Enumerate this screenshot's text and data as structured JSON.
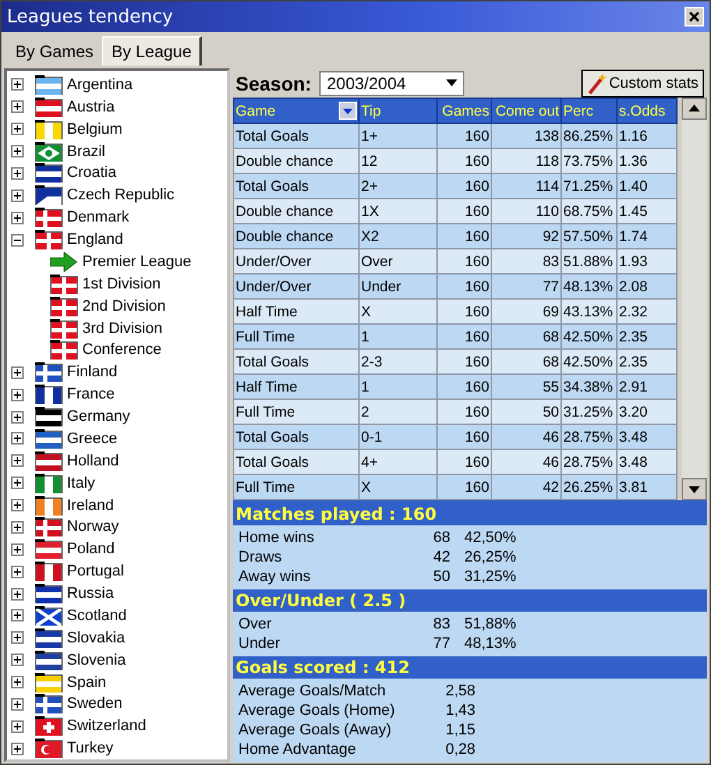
{
  "window": {
    "title": "Leagues tendency"
  },
  "tabs": [
    {
      "label": "By Games",
      "selected": false
    },
    {
      "label": "By League",
      "selected": true
    }
  ],
  "tree": [
    {
      "label": "Argentina",
      "expanded": false,
      "kind": "h",
      "color": "#6cb4ee"
    },
    {
      "label": "Austria",
      "expanded": false,
      "kind": "h",
      "color": "#e01020"
    },
    {
      "label": "Belgium",
      "expanded": false,
      "kind": "v",
      "color": "#f8d800"
    },
    {
      "label": "Brazil",
      "expanded": false,
      "kind": "diamond",
      "color": "#109030"
    },
    {
      "label": "Croatia",
      "expanded": false,
      "kind": "h",
      "color": "#1030a0"
    },
    {
      "label": "Czech Republic",
      "expanded": false,
      "kind": "triangle",
      "color": "#1030a0"
    },
    {
      "label": "Denmark",
      "expanded": false,
      "kind": "nordic",
      "color": "#e01020"
    },
    {
      "label": "England",
      "expanded": true,
      "kind": "cross",
      "color": "#e01020",
      "children": [
        {
          "label": "Premier League",
          "kind": "arrow"
        },
        {
          "label": "1st Division",
          "kind": "flag"
        },
        {
          "label": "2nd Division",
          "kind": "flag"
        },
        {
          "label": "3rd Division",
          "kind": "flag"
        },
        {
          "label": "Conference",
          "kind": "flag"
        }
      ]
    },
    {
      "label": "Finland",
      "expanded": false,
      "kind": "nordic",
      "color": "#2050c0"
    },
    {
      "label": "France",
      "expanded": false,
      "kind": "v",
      "color": "#1030a0"
    },
    {
      "label": "Germany",
      "expanded": false,
      "kind": "h",
      "color": "#000000"
    },
    {
      "label": "Greece",
      "expanded": false,
      "kind": "h",
      "color": "#2060c0"
    },
    {
      "label": "Holland",
      "expanded": false,
      "kind": "h",
      "color": "#c01020"
    },
    {
      "label": "Italy",
      "expanded": false,
      "kind": "v",
      "color": "#109030"
    },
    {
      "label": "Ireland",
      "expanded": false,
      "kind": "v",
      "color": "#f08020"
    },
    {
      "label": "Norway",
      "expanded": false,
      "kind": "nordic",
      "color": "#d01020"
    },
    {
      "label": "Poland",
      "expanded": false,
      "kind": "h",
      "color": "#e02030"
    },
    {
      "label": "Portugal",
      "expanded": false,
      "kind": "v",
      "color": "#d01020"
    },
    {
      "label": "Russia",
      "expanded": false,
      "kind": "h",
      "color": "#1030b0"
    },
    {
      "label": "Scotland",
      "expanded": false,
      "kind": "saltire",
      "color": "#1040d0"
    },
    {
      "label": "Slovakia",
      "expanded": false,
      "kind": "h",
      "color": "#1838a8"
    },
    {
      "label": "Slovenia",
      "expanded": false,
      "kind": "h",
      "color": "#2040a0"
    },
    {
      "label": "Spain",
      "expanded": false,
      "kind": "h",
      "color": "#f8d000"
    },
    {
      "label": "Sweden",
      "expanded": false,
      "kind": "nordic",
      "color": "#2050c0"
    },
    {
      "label": "Switzerland",
      "expanded": false,
      "kind": "plus",
      "color": "#e01020"
    },
    {
      "label": "Turkey",
      "expanded": false,
      "kind": "crescent",
      "color": "#e01828"
    }
  ],
  "season": {
    "label": "Season:",
    "value": "2003/2004"
  },
  "custom_button": "Custom stats",
  "table": {
    "columns": [
      "Game",
      "Tip",
      "Games",
      "Come out",
      "Perc",
      "s.Odds"
    ],
    "rows": [
      [
        "Total Goals",
        "1+",
        "160",
        "138",
        "86.25%",
        "1.16"
      ],
      [
        "Double chance",
        "12",
        "160",
        "118",
        "73.75%",
        "1.36"
      ],
      [
        "Total Goals",
        "2+",
        "160",
        "114",
        "71.25%",
        "1.40"
      ],
      [
        "Double chance",
        "1X",
        "160",
        "110",
        "68.75%",
        "1.45"
      ],
      [
        "Double chance",
        "X2",
        "160",
        "92",
        "57.50%",
        "1.74"
      ],
      [
        "Under/Over",
        "Over",
        "160",
        "83",
        "51.88%",
        "1.93"
      ],
      [
        "Under/Over",
        "Under",
        "160",
        "77",
        "48.13%",
        "2.08"
      ],
      [
        "Half Time",
        "X",
        "160",
        "69",
        "43.13%",
        "2.32"
      ],
      [
        "Full Time",
        "1",
        "160",
        "68",
        "42.50%",
        "2.35"
      ],
      [
        "Total Goals",
        "2-3",
        "160",
        "68",
        "42.50%",
        "2.35"
      ],
      [
        "Half Time",
        "1",
        "160",
        "55",
        "34.38%",
        "2.91"
      ],
      [
        "Full Time",
        "2",
        "160",
        "50",
        "31.25%",
        "3.20"
      ],
      [
        "Total Goals",
        "0-1",
        "160",
        "46",
        "28.75%",
        "3.48"
      ],
      [
        "Total Goals",
        "4+",
        "160",
        "46",
        "28.75%",
        "3.48"
      ],
      [
        "Full Time",
        "X",
        "160",
        "42",
        "26.25%",
        "3.81"
      ]
    ]
  },
  "summary": [
    {
      "title": "Matches played : 160",
      "kind": "counts",
      "rows": [
        [
          "Home wins",
          "68",
          "42,50%"
        ],
        [
          "Draws",
          "42",
          "26,25%"
        ],
        [
          "Away wins",
          "50",
          "31,25%"
        ]
      ]
    },
    {
      "title": "Over/Under ( 2.5 )",
      "kind": "counts",
      "rows": [
        [
          "Over",
          "83",
          "51,88%"
        ],
        [
          "Under",
          "77",
          "48,13%"
        ]
      ]
    },
    {
      "title": "Goals scored : 412",
      "kind": "averages",
      "rows": [
        [
          "Average Goals/Match",
          "2,58"
        ],
        [
          "Average Goals (Home)",
          "1,43"
        ],
        [
          "Average Goals (Away)",
          "1,15"
        ],
        [
          "Home Advantage",
          "0,28"
        ]
      ]
    }
  ]
}
